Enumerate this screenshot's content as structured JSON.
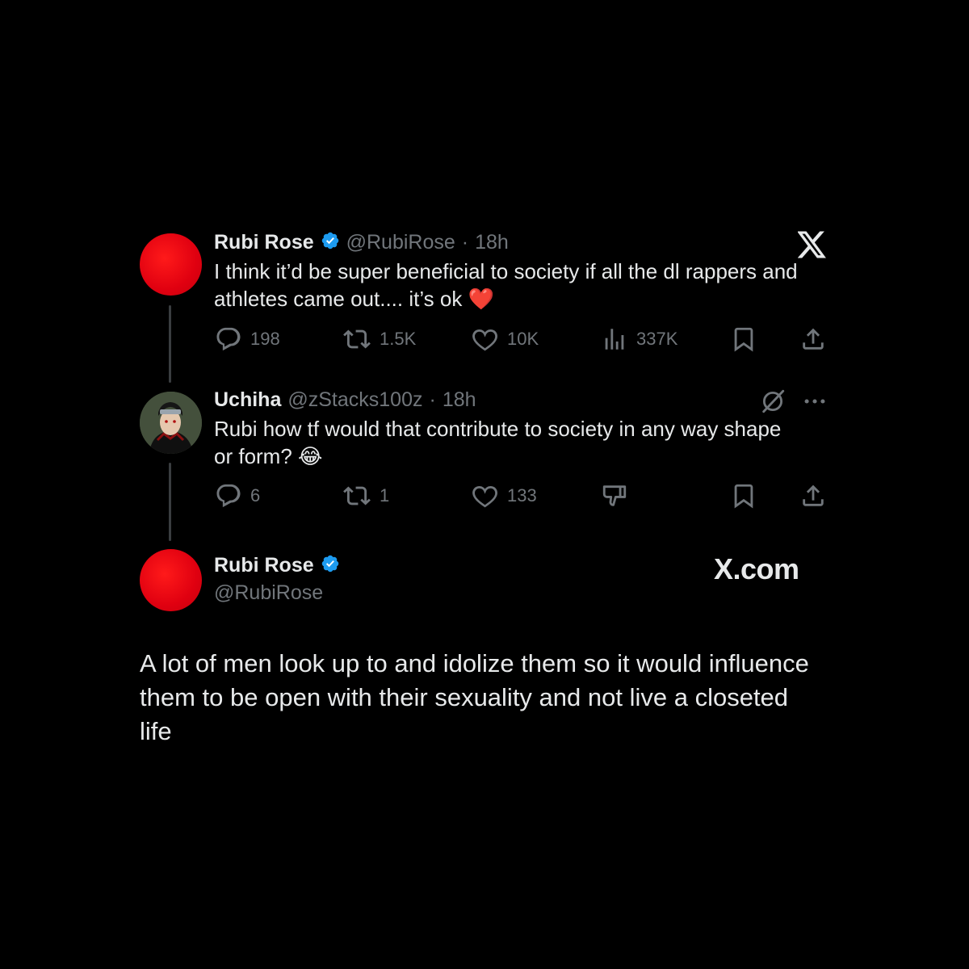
{
  "tweet1": {
    "name": "Rubi Rose",
    "handle": "@RubiRose",
    "sep": "·",
    "time": "18h",
    "text_line1": "I think it’d be super beneficial to society if all the dl rappers and",
    "text_line2": "athletes came out.... it’s ok",
    "emoji": "❤️",
    "stats": {
      "replies": "198",
      "reposts": "1.5K",
      "likes": "10K",
      "views": "337K"
    }
  },
  "tweet2": {
    "name": "Uchiha",
    "handle": "@zStacks100z",
    "sep": "·",
    "time": "18h",
    "text_line1": "Rubi how tf would that contribute to society in any way shape",
    "text_line2": "or form?",
    "emoji": "😂",
    "stats": {
      "replies": "6",
      "reposts": "1",
      "likes": "133"
    }
  },
  "tweet3": {
    "name": "Rubi Rose",
    "handle": "@RubiRose",
    "brand": "X.com",
    "text_line1": "A lot of men look up to and idolize them so it would influence",
    "text_line2": "them to be open with their sexuality and not live a closeted",
    "text_line3": "life"
  },
  "colors": {
    "background": "#000000",
    "text": "#e7e9ea",
    "muted": "#71767b",
    "verified": "#1d9bf0",
    "avatar_red": "#e00010"
  },
  "icons": [
    "x-logo",
    "verified-badge",
    "reply-icon",
    "repost-icon",
    "like-icon",
    "views-icon",
    "bookmark-icon",
    "share-icon",
    "grok-icon",
    "more-icon",
    "downvote-icon"
  ]
}
